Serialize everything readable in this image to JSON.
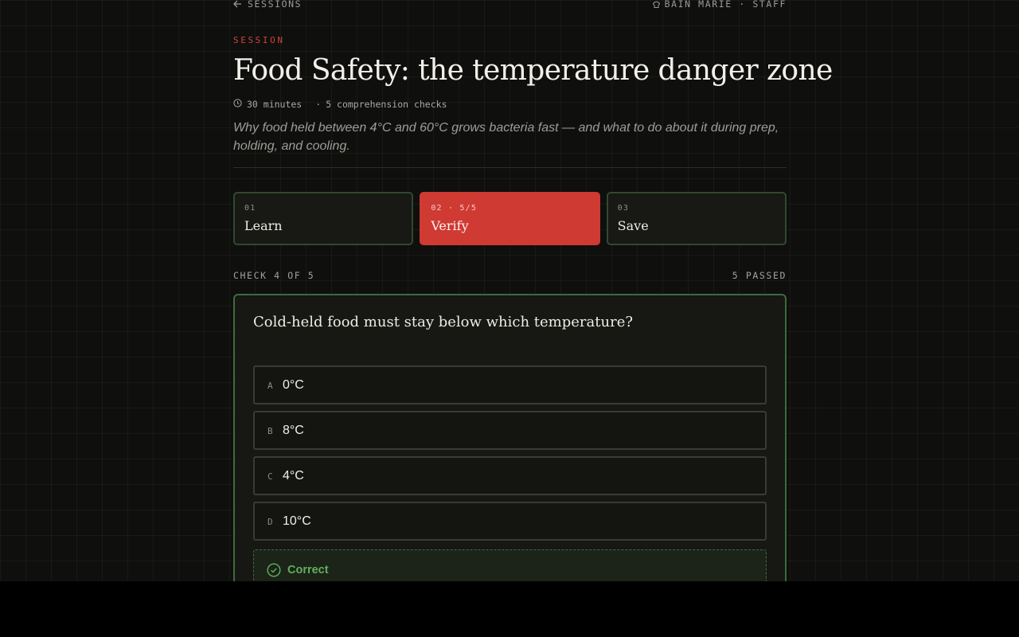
{
  "nav": {
    "back_label": "SESSIONS",
    "brand_label": "BAIN MARIE · STAFF"
  },
  "session": {
    "eyebrow": "SESSION",
    "title": "Food Safety: the temperature danger zone",
    "duration": "30 minutes",
    "separator": "·",
    "checks": "5 comprehension checks",
    "description": "Why food held between 4°C and 60°C grows bacteria fast — and what to do about it during prep, holding, and cooling."
  },
  "steps": [
    {
      "number": "01",
      "label": "Learn",
      "active": false
    },
    {
      "number": "02 · 5/5",
      "label": "Verify",
      "active": true
    },
    {
      "number": "03",
      "label": "Save",
      "active": false
    }
  ],
  "progress": {
    "check_label": "CHECK 4 OF 5",
    "passed_label": "5 PASSED"
  },
  "quiz": {
    "question": "Cold-held food must stay below which temperature?",
    "options": [
      {
        "key": "A",
        "text": "0°C"
      },
      {
        "key": "B",
        "text": "8°C"
      },
      {
        "key": "C",
        "text": "4°C"
      },
      {
        "key": "D",
        "text": "10°C"
      }
    ],
    "feedback": "Correct"
  },
  "colors": {
    "accent_red": "#cf3a33",
    "success_green": "#5fb15a",
    "card_border_green": "#3d6b39",
    "background": "#0f0f0e"
  }
}
